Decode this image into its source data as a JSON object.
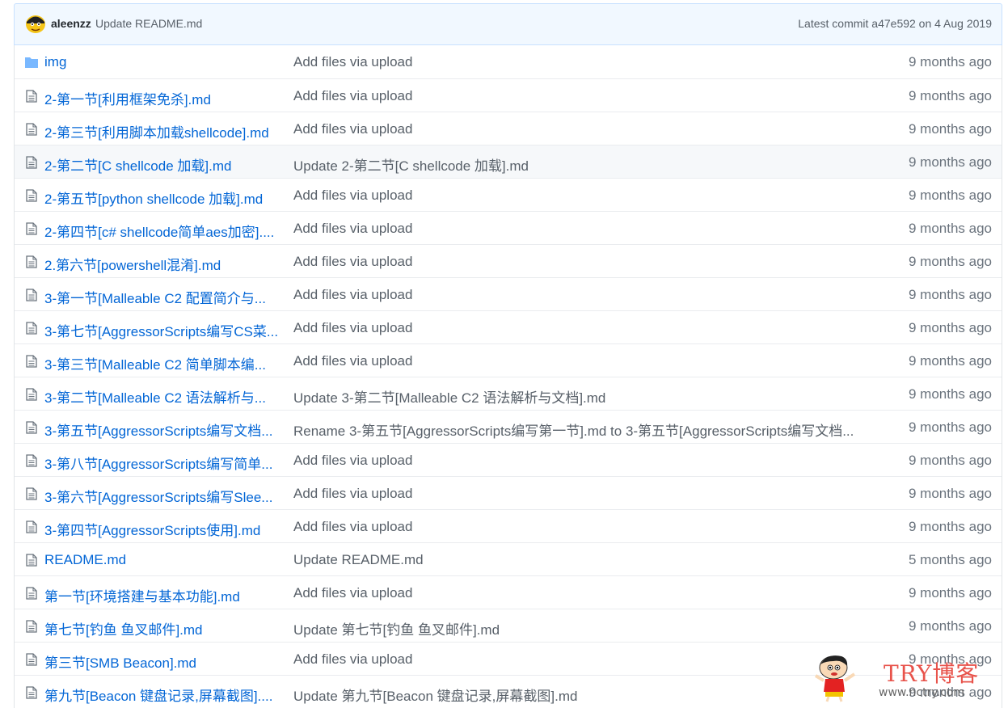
{
  "latest_commit": {
    "author": "aleenzz",
    "message": "Update README.md",
    "meta": "Latest commit a47e592 on 4 Aug 2019"
  },
  "files": [
    {
      "type": "folder",
      "name": "img",
      "message": "Add files via upload",
      "age": "9 months ago"
    },
    {
      "type": "file",
      "name": "2-第一节[利用框架免杀].md",
      "message": "Add files via upload",
      "age": "9 months ago"
    },
    {
      "type": "file",
      "name": "2-第三节[利用脚本加载shellcode].md",
      "message": "Add files via upload",
      "age": "9 months ago"
    },
    {
      "type": "file",
      "name": "2-第二节[C shellcode 加载].md",
      "message": "Update 2-第二节[C shellcode 加载].md",
      "age": "9 months ago"
    },
    {
      "type": "file",
      "name": "2-第五节[python shellcode 加载].md",
      "message": "Add files via upload",
      "age": "9 months ago"
    },
    {
      "type": "file",
      "name": "2-第四节[c# shellcode简单aes加密]....",
      "message": "Add files via upload",
      "age": "9 months ago"
    },
    {
      "type": "file",
      "name": "2.第六节[powershell混淆].md",
      "message": "Add files via upload",
      "age": "9 months ago"
    },
    {
      "type": "file",
      "name": "3-第一节[Malleable C2 配置简介与...",
      "message": "Add files via upload",
      "age": "9 months ago"
    },
    {
      "type": "file",
      "name": "3-第七节[AggressorScripts编写CS菜...",
      "message": "Add files via upload",
      "age": "9 months ago"
    },
    {
      "type": "file",
      "name": "3-第三节[Malleable C2 简单脚本编...",
      "message": "Add files via upload",
      "age": "9 months ago"
    },
    {
      "type": "file",
      "name": "3-第二节[Malleable C2 语法解析与...",
      "message": "Update 3-第二节[Malleable C2 语法解析与文档].md",
      "age": "9 months ago"
    },
    {
      "type": "file",
      "name": "3-第五节[AggressorScripts编写文档...",
      "message": "Rename 3-第五节[AggressorScripts编写第一节].md to 3-第五节[AggressorScripts编写文档...",
      "age": "9 months ago"
    },
    {
      "type": "file",
      "name": "3-第八节[AggressorScripts编写简单...",
      "message": "Add files via upload",
      "age": "9 months ago"
    },
    {
      "type": "file",
      "name": "3-第六节[AggressorScripts编写Slee...",
      "message": "Add files via upload",
      "age": "9 months ago"
    },
    {
      "type": "file",
      "name": "3-第四节[AggressorScripts使用].md",
      "message": "Add files via upload",
      "age": "9 months ago"
    },
    {
      "type": "file",
      "name": "README.md",
      "message": "Update README.md",
      "age": "5 months ago"
    },
    {
      "type": "file",
      "name": "第一节[环境搭建与基本功能].md",
      "message": "Add files via upload",
      "age": "9 months ago"
    },
    {
      "type": "file",
      "name": "第七节[钓鱼 鱼叉邮件].md",
      "message": "Update 第七节[钓鱼 鱼叉邮件].md",
      "age": "9 months ago"
    },
    {
      "type": "file",
      "name": "第三节[SMB Beacon].md",
      "message": "Add files via upload",
      "age": "9 months ago"
    },
    {
      "type": "file",
      "name": "第九节[Beacon 键盘记录,屏幕截图]....",
      "message": "Update 第九节[Beacon 键盘记录,屏幕截图].md",
      "age": "9 months ago"
    }
  ],
  "highlight_row": 3,
  "watermark": {
    "title": "TRY博客",
    "url": "www.nctry.com"
  },
  "colors": {
    "link": "#0366d6",
    "folder_icon": "#79b8ff",
    "file_icon": "#6a737d",
    "commit_bar_bg": "#f1f8ff",
    "watermark_title": "#e8534b"
  }
}
